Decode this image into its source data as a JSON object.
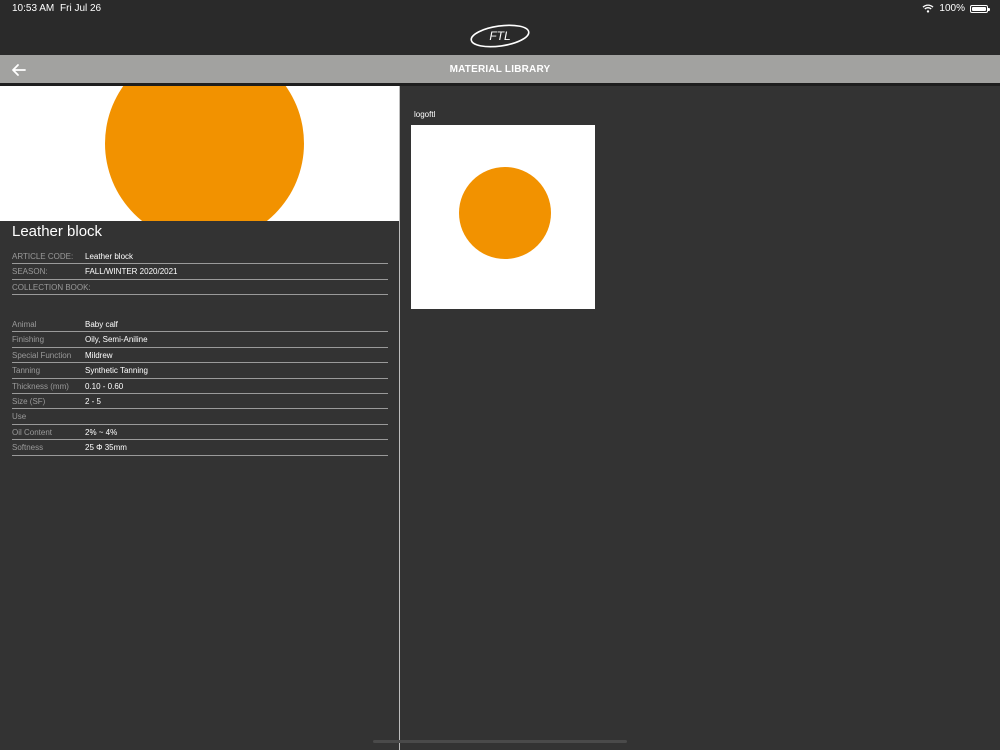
{
  "status_bar": {
    "time": "10:53 AM",
    "date": "Fri Jul 26",
    "battery": "100%",
    "icons": [
      "wifi-icon",
      "battery-icon"
    ]
  },
  "header": {
    "logo_text": "FTL"
  },
  "nav": {
    "title": "MATERIAL LIBRARY",
    "back_icon": "arrow-left-icon"
  },
  "product": {
    "title": "Leather block",
    "image_color": "#f29200",
    "meta": [
      {
        "label": "ARTICLE CODE:",
        "value": "Leather block"
      },
      {
        "label": "SEASON:",
        "value": "FALL/WINTER 2020/2021"
      },
      {
        "label": "COLLECTION BOOK:",
        "value": ""
      }
    ],
    "attributes": [
      {
        "label": "Animal",
        "value": "Baby calf"
      },
      {
        "label": "Finishing",
        "value": "Oily, Semi-Aniline"
      },
      {
        "label": "Special Function",
        "value": "Mildrew"
      },
      {
        "label": "Tanning",
        "value": "Synthetic Tanning"
      },
      {
        "label": "Thickness (mm)",
        "value": "0.10 - 0.60"
      },
      {
        "label": "Size (SF)",
        "value": "2 - 5"
      },
      {
        "label": "Use",
        "value": ""
      },
      {
        "label": "Oil Content",
        "value": "2% ~ 4%"
      },
      {
        "label": "Softness",
        "value": "25 Φ 35mm"
      }
    ]
  },
  "gallery": {
    "items": [
      {
        "label": "logoftl",
        "color": "#f29200"
      }
    ]
  },
  "colors": {
    "accent": "#f29200",
    "nav_bar": "#a2a2a0",
    "background": "#333333"
  }
}
